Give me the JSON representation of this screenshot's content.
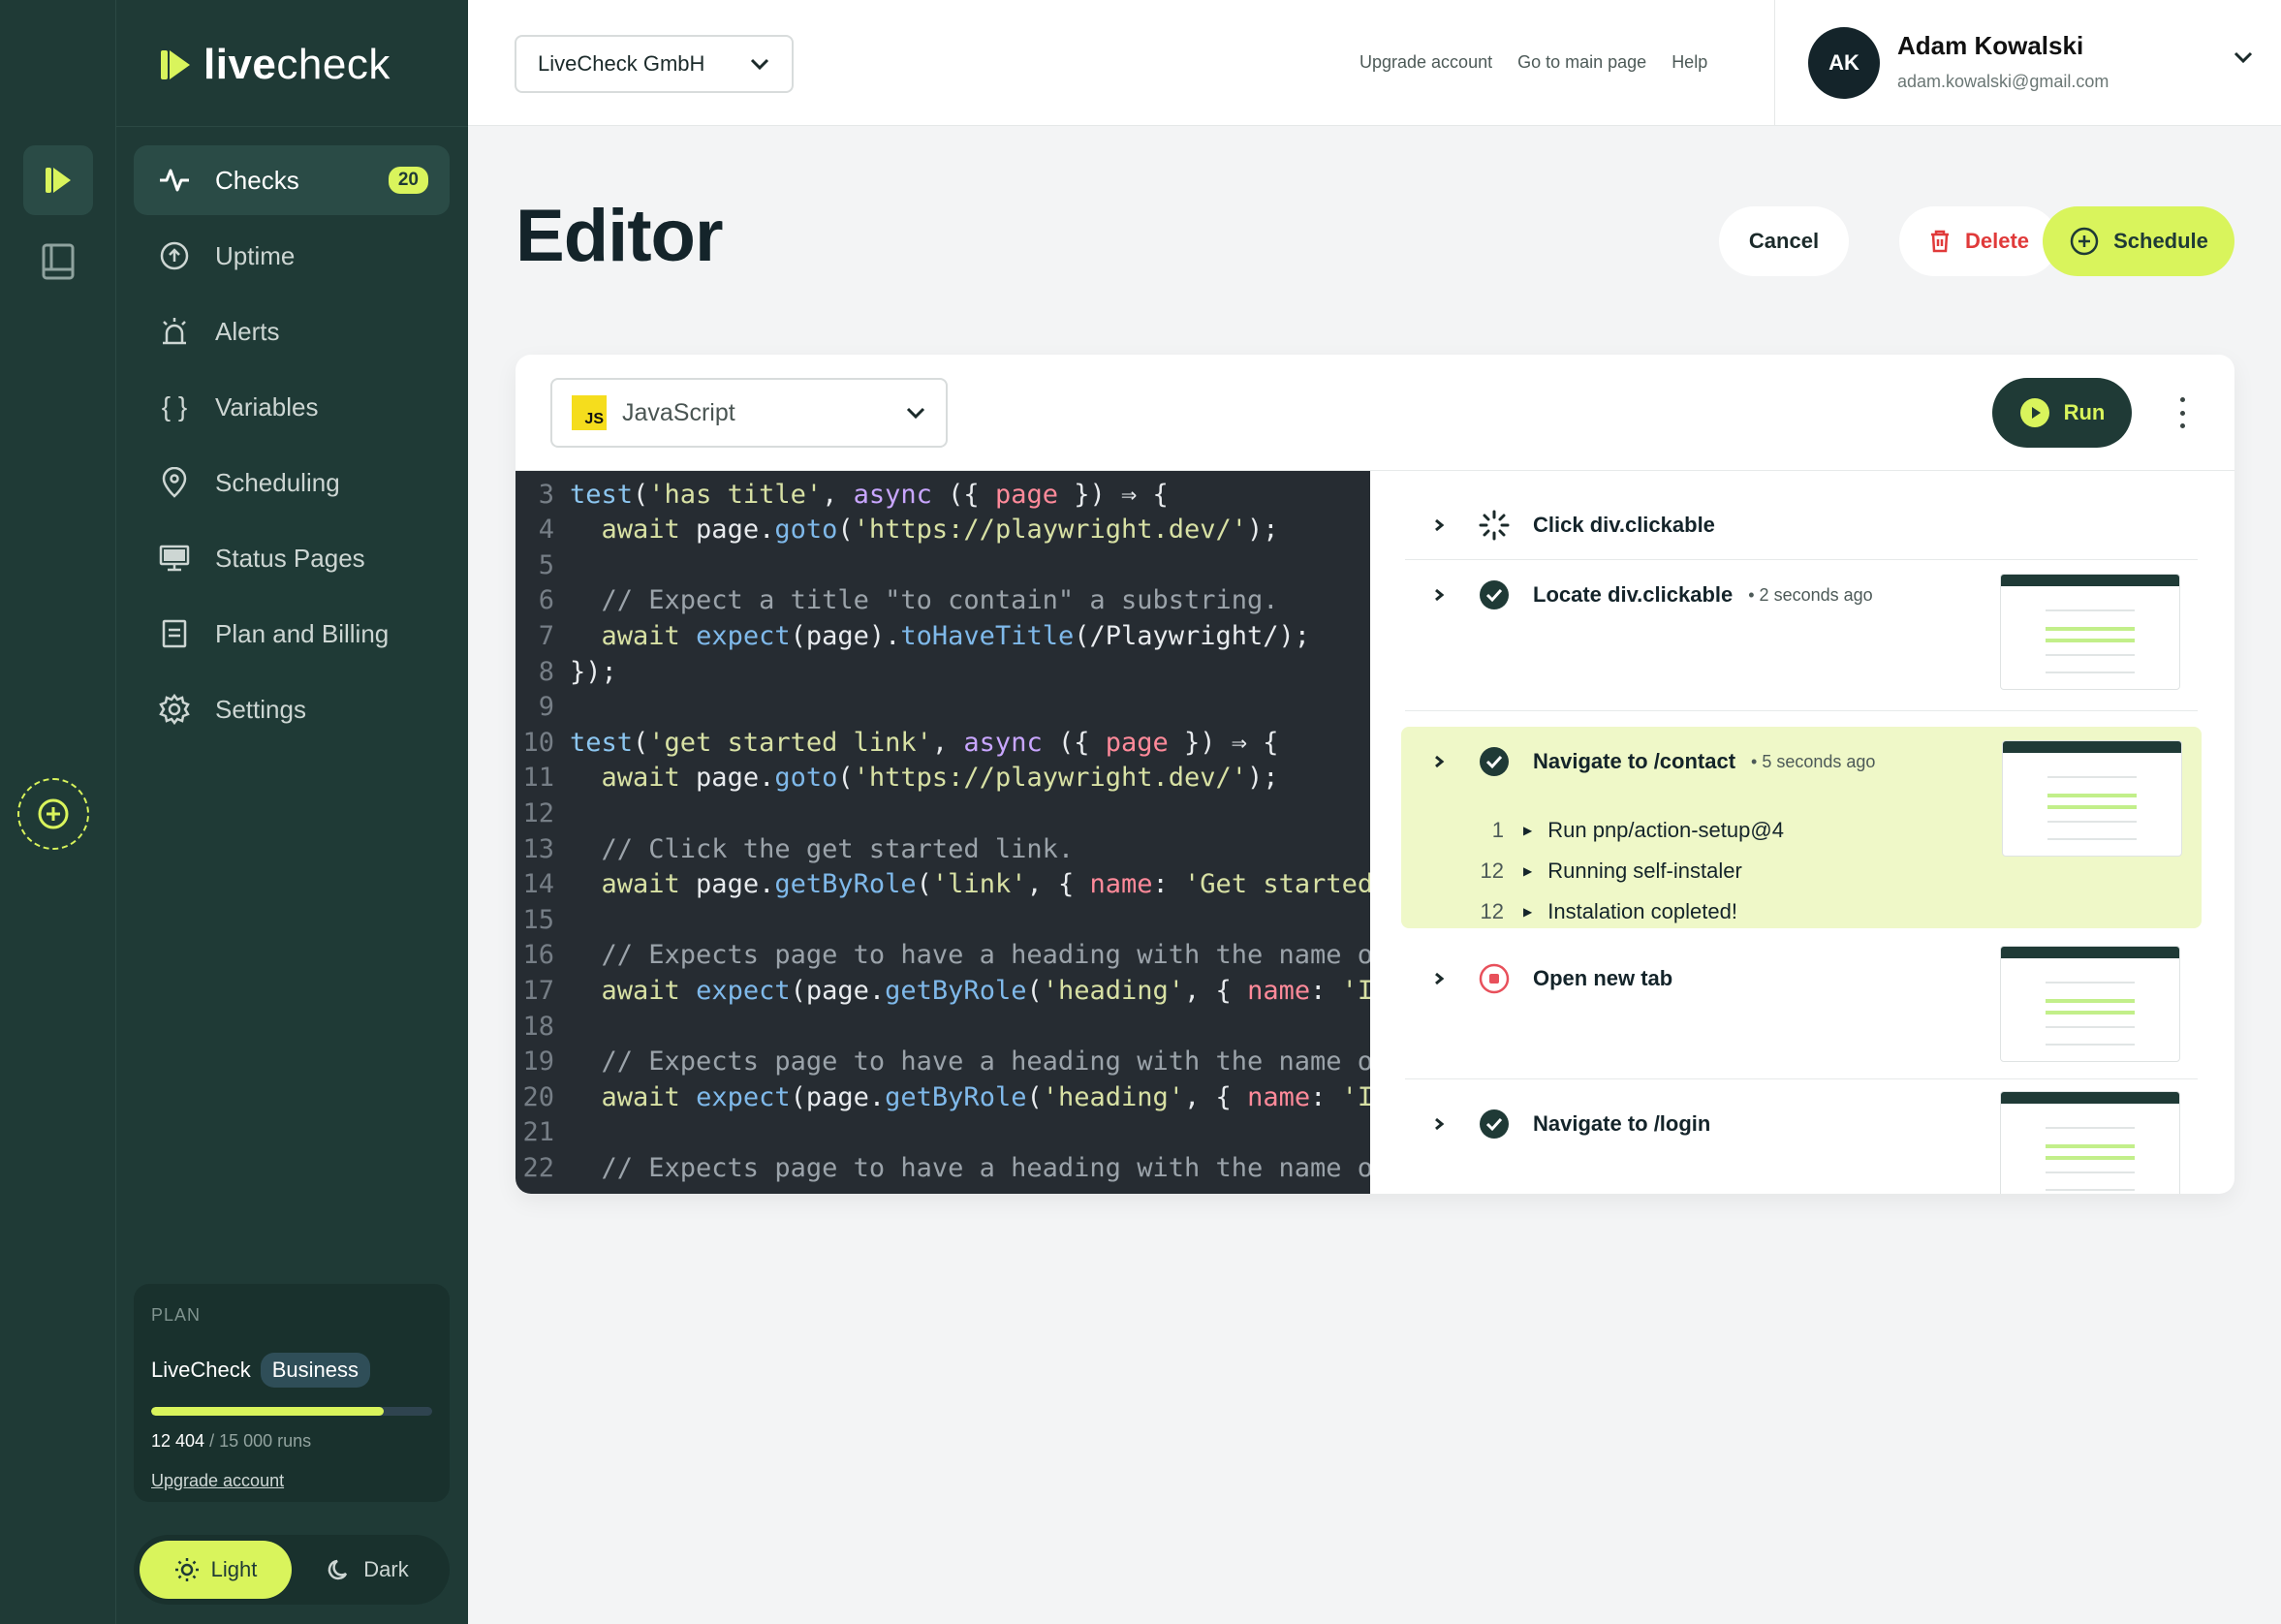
{
  "brand": {
    "live": "live",
    "check": "check"
  },
  "nav": {
    "items": [
      {
        "label": "Checks",
        "badge": "20"
      },
      {
        "label": "Uptime"
      },
      {
        "label": "Alerts"
      },
      {
        "label": "Variables"
      },
      {
        "label": "Scheduling"
      },
      {
        "label": "Status Pages"
      },
      {
        "label": "Plan and Billing"
      },
      {
        "label": "Settings"
      }
    ]
  },
  "plan": {
    "label": "PLAN",
    "product": "LiveCheck",
    "tier": "Business",
    "used": "12 404",
    "total": "/ 15 000 runs",
    "usage_fraction": 0.827,
    "upgrade_link": "Upgrade account"
  },
  "theme": {
    "light": "Light",
    "dark": "Dark",
    "selected": "light"
  },
  "topbar": {
    "org": "LiveCheck GmbH",
    "links": [
      "Upgrade account",
      "Go to main page",
      "Help"
    ],
    "user": {
      "initials": "AK",
      "name": "Adam Kowalski",
      "email": "adam.kowalski@gmail.com"
    }
  },
  "page": {
    "title": "Editor"
  },
  "actions": {
    "cancel": "Cancel",
    "delete": "Delete",
    "schedule": "Schedule"
  },
  "editor": {
    "language": "JavaScript",
    "language_badge": "JS",
    "run": "Run"
  },
  "code_lines": [
    {
      "n": "3",
      "html": "<span class='tok-kw'>test</span><span class='tok-pl'>(</span><span class='tok-str'>'has title'</span><span class='tok-pl'>, </span><span class='tok-async'>async</span><span class='tok-pl'> ({ </span><span class='tok-param'>page</span><span class='tok-pl'> }) ⇒ {</span>"
    },
    {
      "n": "4",
      "html": "<span class='tok-pl'>  </span><span class='tok-str'>await</span><span class='tok-pl'> page.</span><span class='tok-fn'>goto</span><span class='tok-pl'>(</span><span class='tok-str'>'https://playwright.dev/'</span><span class='tok-pl'>);</span>"
    },
    {
      "n": "5",
      "html": ""
    },
    {
      "n": "6",
      "html": "<span class='tok-cm'>  // Expect a title \"to contain\" a substring.</span>"
    },
    {
      "n": "7",
      "html": "<span class='tok-pl'>  </span><span class='tok-str'>await</span><span class='tok-pl'> </span><span class='tok-fn'>expect</span><span class='tok-pl'>(page).</span><span class='tok-fn'>toHaveTitle</span><span class='tok-pl'>(/Playwright/);</span>"
    },
    {
      "n": "8",
      "html": "<span class='tok-pl'>});</span>"
    },
    {
      "n": "9",
      "html": ""
    },
    {
      "n": "10",
      "html": "<span class='tok-kw'>test</span><span class='tok-pl'>(</span><span class='tok-str'>'get started link'</span><span class='tok-pl'>, </span><span class='tok-async'>async</span><span class='tok-pl'> ({ </span><span class='tok-param'>page</span><span class='tok-pl'> }) ⇒ {</span>"
    },
    {
      "n": "11",
      "html": "<span class='tok-pl'>  </span><span class='tok-str'>await</span><span class='tok-pl'> page.</span><span class='tok-fn'>goto</span><span class='tok-pl'>(</span><span class='tok-str'>'https://playwright.dev/'</span><span class='tok-pl'>);</span>"
    },
    {
      "n": "12",
      "html": ""
    },
    {
      "n": "13",
      "html": "<span class='tok-cm'>  // Click the get started link.</span>"
    },
    {
      "n": "14",
      "html": "<span class='tok-pl'>  </span><span class='tok-str'>await</span><span class='tok-pl'> page.</span><span class='tok-fn'>getByRole</span><span class='tok-pl'>(</span><span class='tok-str'>'link'</span><span class='tok-pl'>, { </span><span class='tok-param'>name</span><span class='tok-pl'>: </span><span class='tok-str'>'Get started'</span>"
    },
    {
      "n": "15",
      "html": ""
    },
    {
      "n": "16",
      "html": "<span class='tok-cm'>  // Expects page to have a heading with the name of</span>"
    },
    {
      "n": "17",
      "html": "<span class='tok-pl'>  </span><span class='tok-str'>await</span><span class='tok-pl'> </span><span class='tok-fn'>expect</span><span class='tok-pl'>(page.</span><span class='tok-fn'>getByRole</span><span class='tok-pl'>(</span><span class='tok-str'>'heading'</span><span class='tok-pl'>, { </span><span class='tok-param'>name</span><span class='tok-pl'>: </span><span class='tok-str'>'Ins</span>"
    },
    {
      "n": "18",
      "html": ""
    },
    {
      "n": "19",
      "html": "<span class='tok-cm'>  // Expects page to have a heading with the name of</span>"
    },
    {
      "n": "20",
      "html": "<span class='tok-pl'>  </span><span class='tok-str'>await</span><span class='tok-pl'> </span><span class='tok-fn'>expect</span><span class='tok-pl'>(page.</span><span class='tok-fn'>getByRole</span><span class='tok-pl'>(</span><span class='tok-str'>'heading'</span><span class='tok-pl'>, { </span><span class='tok-param'>name</span><span class='tok-pl'>: </span><span class='tok-str'>'Ins</span>"
    },
    {
      "n": "21",
      "html": ""
    },
    {
      "n": "22",
      "html": "<span class='tok-cm'>  // Expects page to have a heading with the name of</span>"
    }
  ],
  "steps": [
    {
      "title": "Click div.clickable",
      "time": "",
      "status": "loading"
    },
    {
      "title": "Locate div.clickable",
      "time": "• 2 seconds ago",
      "status": "success"
    },
    {
      "title": "Navigate to /contact",
      "time": "• 5 seconds ago",
      "status": "success",
      "substeps": [
        {
          "num": "1",
          "label": "Run pnp/action-setup@4"
        },
        {
          "num": "12",
          "label": "Running self-instaler"
        },
        {
          "num": "12",
          "label": "Instalation copleted!"
        }
      ]
    },
    {
      "title": "Open new tab",
      "time": "",
      "status": "stopped"
    },
    {
      "title": "Navigate to /login",
      "time": "",
      "status": "success"
    }
  ],
  "colors": {
    "accent": "#d9f45c",
    "sidebar": "#1f3a36",
    "danger": "#e03a3a",
    "highlight": "#eff8c8"
  }
}
